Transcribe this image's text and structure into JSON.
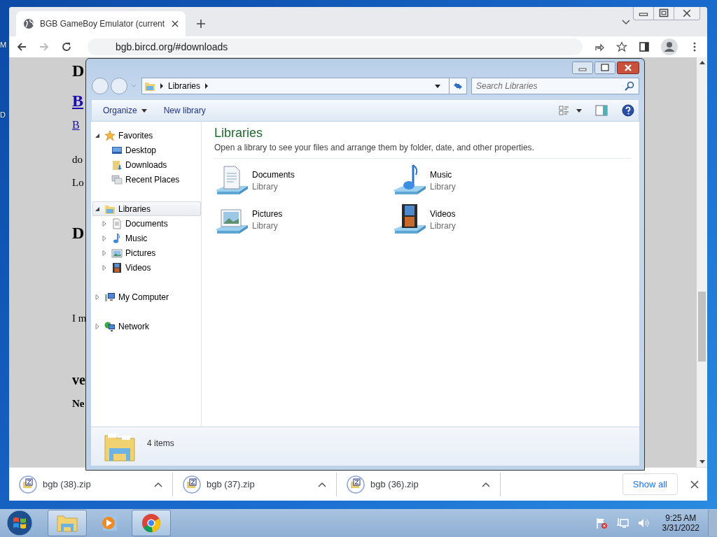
{
  "desktop_icons": [
    {
      "label": "M"
    },
    {
      "label": "D"
    }
  ],
  "browser": {
    "tab": {
      "title": "BGB GameBoy Emulator (current"
    },
    "address": "bgb.bircd.org/#downloads",
    "page_fragments": [
      {
        "kind": "heading",
        "text": "D"
      },
      {
        "kind": "title_link",
        "text": "B"
      },
      {
        "kind": "link",
        "text": "B"
      },
      {
        "kind": "text",
        "text": "do"
      },
      {
        "kind": "text",
        "text": "Lo"
      },
      {
        "kind": "heading",
        "text": "D"
      },
      {
        "kind": "text",
        "text": "I m"
      },
      {
        "kind": "subheading",
        "text": "ve"
      },
      {
        "kind": "bold",
        "text": "Ne"
      }
    ],
    "downloads": [
      {
        "name": "bgb (38).zip"
      },
      {
        "name": "bgb (37).zip"
      },
      {
        "name": "bgb (36).zip"
      }
    ],
    "show_all": "Show all"
  },
  "explorer": {
    "breadcrumbs": [
      "Libraries"
    ],
    "search": {
      "placeholder": "Search Libraries"
    },
    "toolbar": [
      {
        "label": "Organize",
        "dropdown": true
      },
      {
        "label": "New library",
        "dropdown": false
      }
    ],
    "nav": [
      {
        "label": "Favorites",
        "kind": "star",
        "expanded": true,
        "selected": false,
        "children": [
          {
            "label": "Desktop",
            "kind": "desktop",
            "selected": false
          },
          {
            "label": "Downloads",
            "kind": "downloads",
            "selected": false
          },
          {
            "label": "Recent Places",
            "kind": "recent",
            "selected": false
          }
        ]
      },
      {
        "label": "Libraries",
        "kind": "library",
        "expanded": true,
        "selected": true,
        "children": [
          {
            "label": "Documents",
            "kind": "documents",
            "expanded": false,
            "selected": false
          },
          {
            "label": "Music",
            "kind": "music",
            "expanded": false,
            "selected": false
          },
          {
            "label": "Pictures",
            "kind": "pictures",
            "expanded": false,
            "selected": false
          },
          {
            "label": "Videos",
            "kind": "videos",
            "expanded": false,
            "selected": false
          }
        ]
      },
      {
        "label": "My Computer",
        "kind": "computer",
        "expanded": false,
        "selected": false
      },
      {
        "label": "Network",
        "kind": "network",
        "expanded": false,
        "selected": false
      }
    ],
    "heading": "Libraries",
    "description": "Open a library to see your files and arrange them by folder, date, and other properties.",
    "items": [
      {
        "name": "Documents",
        "type": "Library",
        "kind": "documents"
      },
      {
        "name": "Music",
        "type": "Library",
        "kind": "music"
      },
      {
        "name": "Pictures",
        "type": "Library",
        "kind": "pictures"
      },
      {
        "name": "Videos",
        "type": "Library",
        "kind": "videos"
      }
    ],
    "status": "4 items"
  },
  "taskbar": {
    "apps": [
      {
        "kind": "explorer",
        "selected": true
      },
      {
        "kind": "media",
        "selected": false
      },
      {
        "kind": "chrome",
        "selected": true
      }
    ],
    "time": "9:25 AM",
    "date": "3/31/2022"
  }
}
